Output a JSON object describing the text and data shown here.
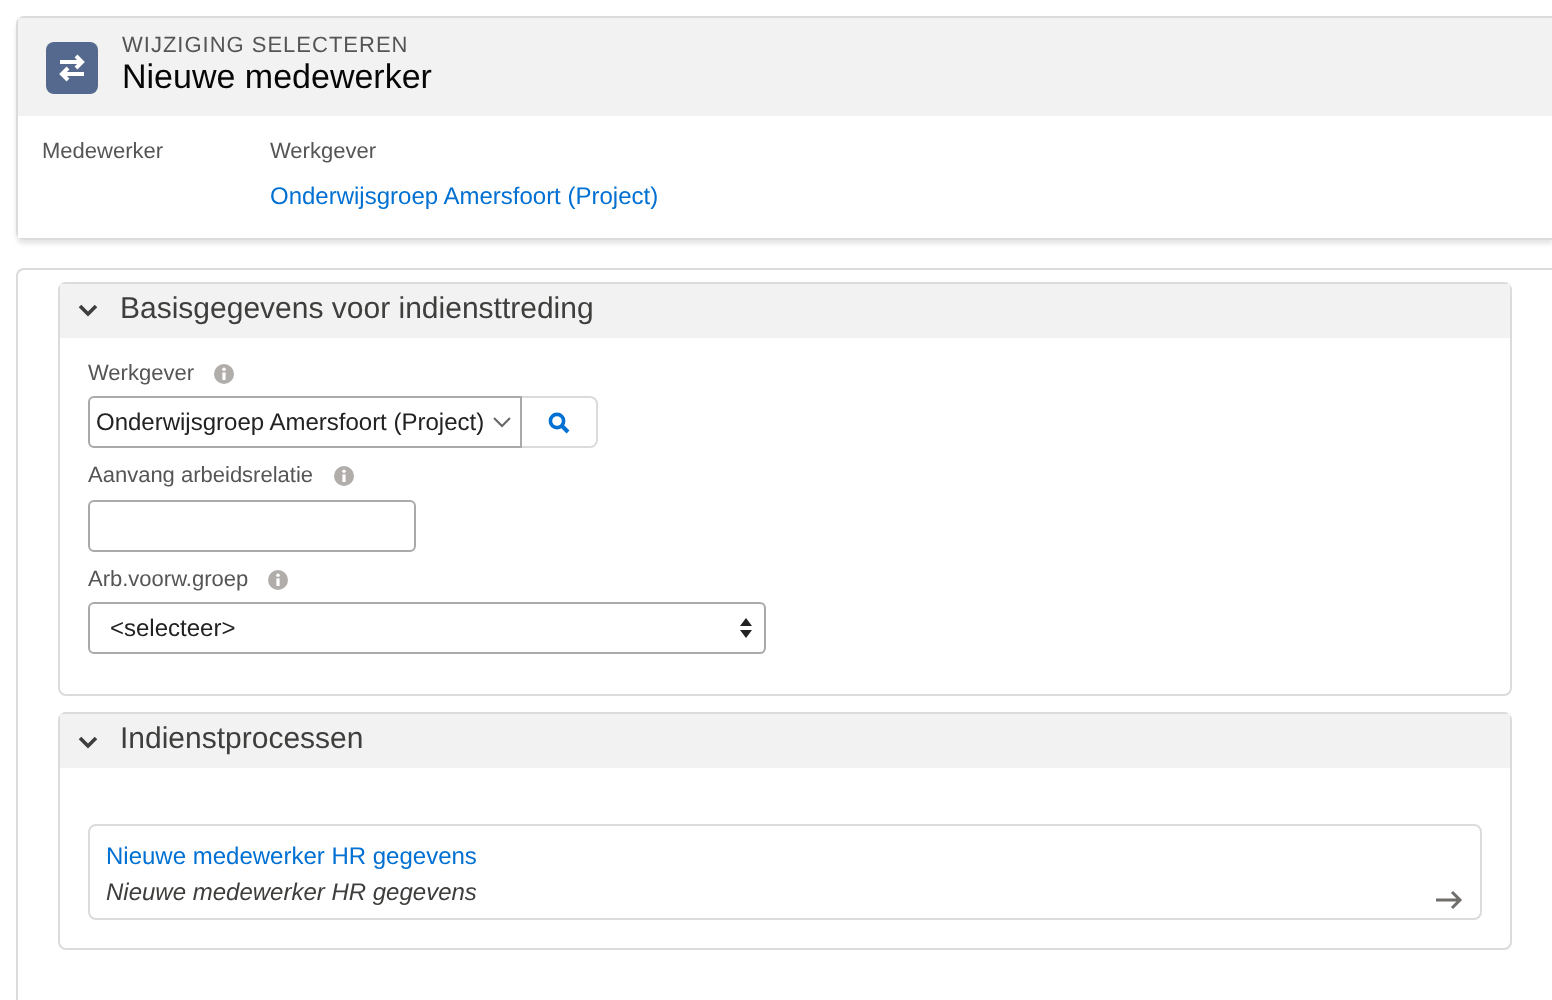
{
  "header": {
    "eyebrow": "WIJZIGING SELECTEREN",
    "title": "Nieuwe medewerker"
  },
  "details": [
    {
      "label": "Medewerker"
    },
    {
      "label": "Werkgever",
      "value": "Onderwijsgroep Amersfoort (Project)"
    }
  ],
  "sections": [
    {
      "title": "Basisgegevens voor indiensttreding",
      "expanded": true,
      "kind": "form",
      "fields": [
        {
          "kind": "lookup",
          "label": "Werkgever",
          "value": "Onderwijsgroep Amersfoort (Project)"
        },
        {
          "kind": "text",
          "label": "Aanvang arbeidsrelatie"
        },
        {
          "kind": "select",
          "label": "Arb.voorw.groep",
          "value": "<selecteer>"
        }
      ]
    },
    {
      "title": "Indienstprocessen",
      "expanded": true,
      "kind": "processes",
      "items": [
        {
          "title": "Nieuwe medewerker HR gegevens",
          "subtitle": "Nieuwe medewerker HR gegevens"
        }
      ]
    }
  ]
}
